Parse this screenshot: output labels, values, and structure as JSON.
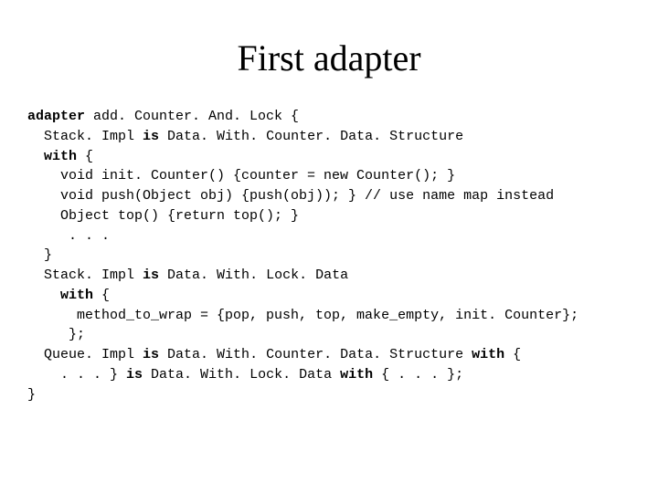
{
  "title": "First adapter",
  "code": {
    "l1a": "adapter",
    "l1b": " add. Counter. And. Lock {",
    "l2a": "  Stack. Impl ",
    "l2b": "is",
    "l2c": " Data. With. Counter. Data. Structure",
    "l3a": "  ",
    "l3b": "with",
    "l3c": " {",
    "l4": "    void init. Counter() {counter = new Counter(); }",
    "l5": "    void push(Object obj) {push(obj)); } // use name map instead",
    "l6": "    Object top() {return top(); }",
    "l7": "     . . .",
    "l8": "  }",
    "l9a": "  Stack. Impl ",
    "l9b": "is",
    "l9c": " Data. With. Lock. Data",
    "l10a": "    ",
    "l10b": "with",
    "l10c": " {",
    "l11": "      method_to_wrap = {pop, push, top, make_empty, init. Counter};",
    "l12": "     };",
    "l13a": "  Queue. Impl ",
    "l13b": "is",
    "l13c": " Data. With. Counter. Data. Structure ",
    "l13d": "with",
    "l13e": " {",
    "l14a": "    . . . } ",
    "l14b": "is",
    "l14c": " Data. With. Lock. Data ",
    "l14d": "with",
    "l14e": " { . . . };",
    "l15": "}"
  }
}
